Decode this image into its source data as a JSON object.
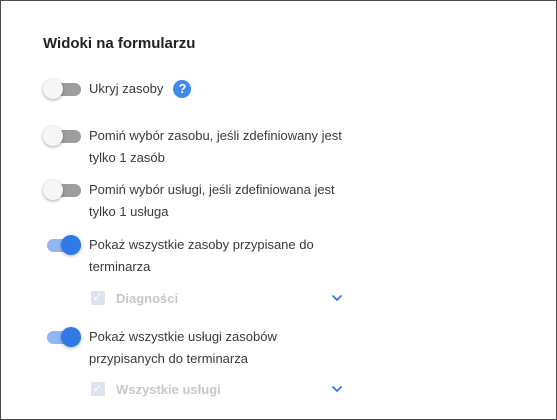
{
  "section_title": "Widoki na formularzu",
  "help_icon_label": "?",
  "settings": [
    {
      "line1": "Ukryj zasoby",
      "line2": "",
      "enabled": false
    },
    {
      "line1": "Pomiń wybór zasobu, jeśli zdefiniowany jest",
      "line2": "tylko 1 zasób",
      "enabled": false
    },
    {
      "line1": "Pomiń wybór usługi, jeśli zdefiniowana jest",
      "line2": "tylko 1 usługa",
      "enabled": false
    },
    {
      "line1": "Pokaż wszystkie zasoby przypisane do",
      "line2": "terminarza",
      "enabled": true
    },
    {
      "line1": "Pokaż wszystkie usługi zasobów",
      "line2": "przypisanych do terminarza",
      "enabled": true
    }
  ],
  "dropdowns": [
    {
      "selected": "Diagności",
      "checked": true,
      "disabled": true
    },
    {
      "selected": "Wszystkie usługi",
      "checked": true,
      "disabled": true
    }
  ],
  "colors": {
    "toggle_on": "#2f7ae5",
    "toggle_off": "#9e9e9e",
    "help_icon": "#3d8bf0",
    "chevron": "#2f7ae5",
    "disabled_text": "#c8c8c8"
  },
  "icons": {
    "help": "question-circle-icon",
    "chevron": "chevron-down-icon",
    "checkbox": "checkmark-icon"
  }
}
